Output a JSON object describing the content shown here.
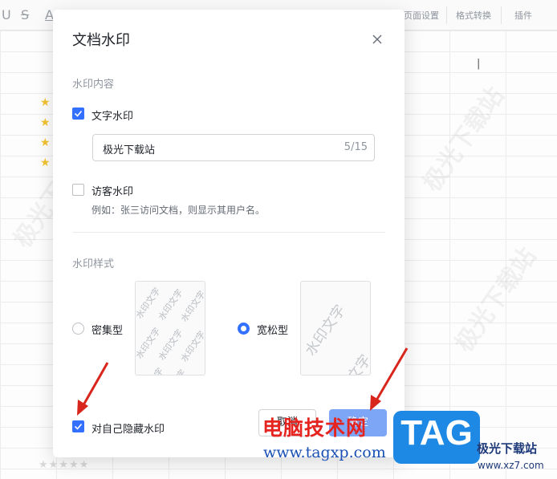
{
  "toolbar": {
    "page_setup": "页面设置",
    "format_convert": "格式转换",
    "plugins": "插件"
  },
  "dialog": {
    "title": "文档水印",
    "content_section": "水印内容",
    "text_watermark": {
      "label": "文字水印",
      "checked": true,
      "value": "极光下载站",
      "count": "5/15"
    },
    "visitor_watermark": {
      "label": "访客水印",
      "checked": false,
      "hint": "例如：张三访问文档，则显示其用户名。"
    },
    "style_section": "水印样式",
    "styles": [
      {
        "label": "密集型",
        "selected": false
      },
      {
        "label": "宽松型",
        "selected": true
      }
    ],
    "preview_text": "水印文字",
    "hide_self": {
      "label": "对自己隐藏水印",
      "checked": true
    },
    "cancel_label": "取消",
    "ok_label": "确定"
  },
  "overlay": {
    "brand_red": "电脑技术网",
    "brand_url": "www.tagxp.com",
    "tag": "TAG",
    "site_name": "极光下载站",
    "site_url": "www.xz7.com",
    "bg_watermark": "极光下载站"
  },
  "colors": {
    "accent": "#3370ff",
    "ok_button": "#7ea6f7",
    "arrow": "#d9261c",
    "brand_red": "#e52420",
    "tag_blue": "#1e88e5"
  }
}
